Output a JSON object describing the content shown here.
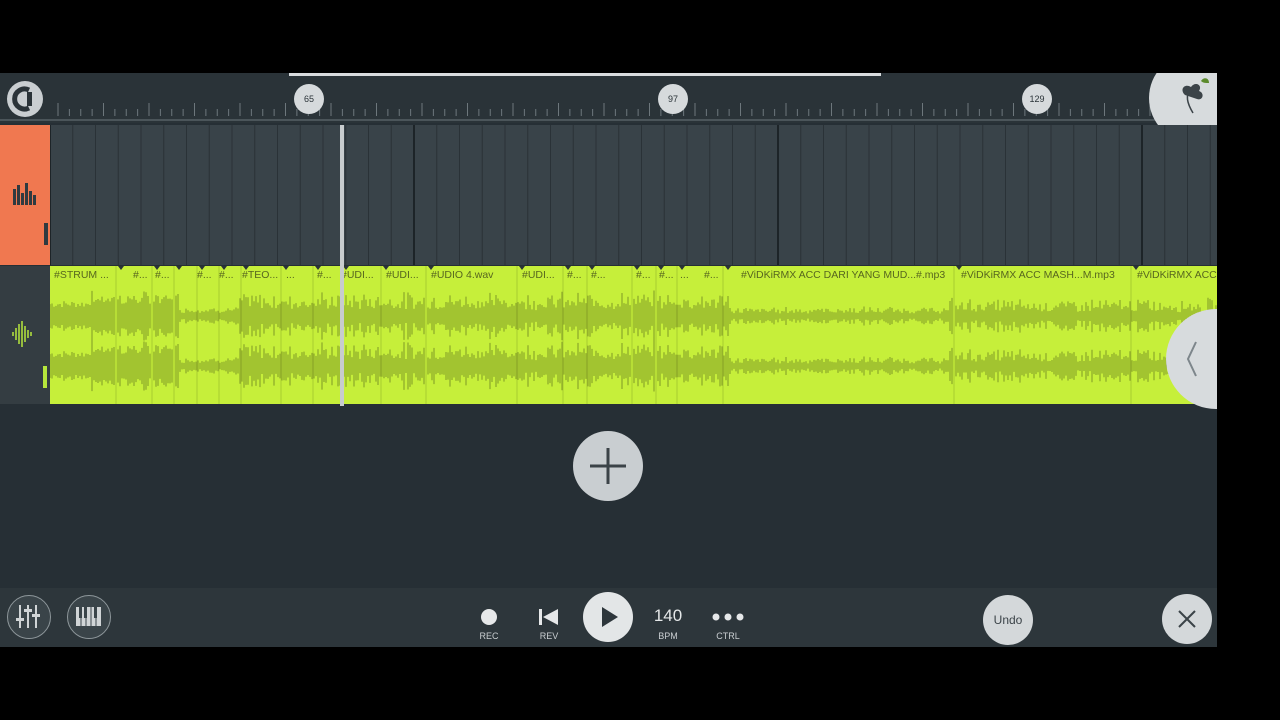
{
  "timeline": {
    "bar_markers": [
      "65",
      "97",
      "129"
    ]
  },
  "clips": [
    "#STRUM ...",
    "#...",
    "#...",
    "#...",
    "#...",
    "#TEO...",
    "...",
    "#...",
    "#UDI...",
    "#UDI...",
    "#UDIO 4.wav",
    "#UDI...",
    "#...",
    "#...",
    "#...",
    "#...",
    "...",
    "#...",
    "#ViDKiRMX ACC DARI YANG MUD...#.mp3",
    "#ViDKiRMX ACC MASH...M.mp3",
    "#ViDKiRMX ACC"
  ],
  "transport": {
    "rec_label": "REC",
    "rev_label": "REV",
    "bpm_value": "140",
    "bpm_label": "BPM",
    "ctrl_label": "CTRL",
    "undo_label": "Undo"
  },
  "colors": {
    "accent_orange": "#f07850",
    "audio_clip": "#c6ef3a",
    "waveform": "#7f9826",
    "background": "#262f35"
  },
  "icons": {
    "magnet": "magnet-icon",
    "menu": "fl-fruit-icon",
    "track1": "bar-chart-icon",
    "track2": "waveform-icon",
    "add": "plus-icon",
    "mixer": "mixer-sliders-icon",
    "piano": "piano-icon",
    "record": "record-dot-icon",
    "rewind": "skip-back-icon",
    "play": "play-icon",
    "ctrl": "ellipsis-icon",
    "close": "close-icon",
    "collapse": "chevron-left-icon"
  }
}
